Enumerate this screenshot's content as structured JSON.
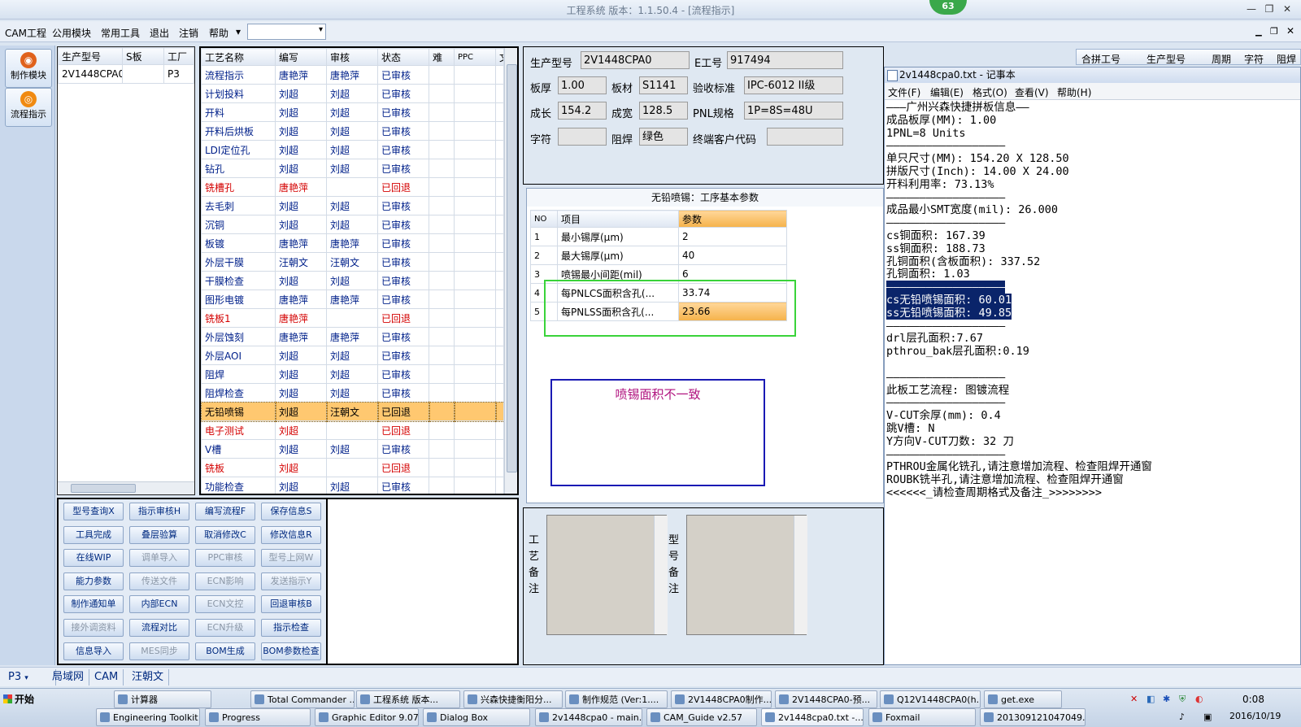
{
  "window": {
    "title": "工程系统   版本：1.1.50.4 - [流程指示]",
    "badge": "63"
  },
  "menu": {
    "items": [
      "CAM工程",
      "公用模块",
      "常用工具",
      "退出",
      "注销",
      "帮助"
    ],
    "arrow": "▾",
    "combo": ""
  },
  "left_tools": [
    {
      "label": "制作模块"
    },
    {
      "label": "流程指示"
    }
  ],
  "prod_grid": {
    "headers": [
      "生产型号",
      "S板",
      "工厂"
    ],
    "rows": [
      [
        "2V1448CPA0",
        "",
        "P3"
      ]
    ]
  },
  "process_grid": {
    "headers": [
      "工艺名称",
      "编写",
      "审核",
      "状态",
      "难",
      "PPC",
      "文控"
    ],
    "rows": [
      {
        "name": "流程指示",
        "author": "唐艳萍",
        "reviewer": "唐艳萍",
        "status": "已审核",
        "red": false
      },
      {
        "name": "计划投料",
        "author": "刘超",
        "reviewer": "刘超",
        "status": "已审核",
        "red": false
      },
      {
        "name": "开料",
        "author": "刘超",
        "reviewer": "刘超",
        "status": "已审核",
        "red": false
      },
      {
        "name": "开料后烘板",
        "author": "刘超",
        "reviewer": "刘超",
        "status": "已审核",
        "red": false
      },
      {
        "name": "LDI定位孔",
        "author": "刘超",
        "reviewer": "刘超",
        "status": "已审核",
        "red": false
      },
      {
        "name": "钻孔",
        "author": "刘超",
        "reviewer": "刘超",
        "status": "已审核",
        "red": false
      },
      {
        "name": "铣槽孔",
        "author": "唐艳萍",
        "reviewer": "",
        "status": "已回退",
        "red": true
      },
      {
        "name": "去毛刺",
        "author": "刘超",
        "reviewer": "刘超",
        "status": "已审核",
        "red": false
      },
      {
        "name": "沉铜",
        "author": "刘超",
        "reviewer": "刘超",
        "status": "已审核",
        "red": false
      },
      {
        "name": "板镀",
        "author": "唐艳萍",
        "reviewer": "唐艳萍",
        "status": "已审核",
        "red": false
      },
      {
        "name": "外层干膜",
        "author": "汪朝文",
        "reviewer": "汪朝文",
        "status": "已审核",
        "red": false
      },
      {
        "name": "干膜检查",
        "author": "刘超",
        "reviewer": "刘超",
        "status": "已审核",
        "red": false
      },
      {
        "name": "图形电镀",
        "author": "唐艳萍",
        "reviewer": "唐艳萍",
        "status": "已审核",
        "red": false
      },
      {
        "name": "铣板1",
        "author": "唐艳萍",
        "reviewer": "",
        "status": "已回退",
        "red": true
      },
      {
        "name": "外层蚀刻",
        "author": "唐艳萍",
        "reviewer": "唐艳萍",
        "status": "已审核",
        "red": false
      },
      {
        "name": "外层AOI",
        "author": "刘超",
        "reviewer": "刘超",
        "status": "已审核",
        "red": false
      },
      {
        "name": "阻焊",
        "author": "刘超",
        "reviewer": "刘超",
        "status": "已审核",
        "red": false
      },
      {
        "name": "阻焊检查",
        "author": "刘超",
        "reviewer": "刘超",
        "status": "已审核",
        "red": false
      },
      {
        "name": "无铅喷锡",
        "author": "刘超",
        "reviewer": "汪朝文",
        "status": "已回退",
        "red": false,
        "selected": true
      },
      {
        "name": "电子测试",
        "author": "刘超",
        "reviewer": "",
        "status": "已回退",
        "red": true
      },
      {
        "name": "V槽",
        "author": "刘超",
        "reviewer": "刘超",
        "status": "已审核",
        "red": false
      },
      {
        "name": "铣板",
        "author": "刘超",
        "reviewer": "",
        "status": "已回退",
        "red": true
      },
      {
        "name": "功能检查",
        "author": "刘超",
        "reviewer": "刘超",
        "status": "已审核",
        "red": false
      }
    ]
  },
  "buttons": [
    [
      {
        "label": "型号查询X",
        "enabled": true
      },
      {
        "label": "指示审核H",
        "enabled": true
      },
      {
        "label": "编写流程F",
        "enabled": true
      },
      {
        "label": "保存信息S",
        "enabled": true
      }
    ],
    [
      {
        "label": "工具完成",
        "enabled": true
      },
      {
        "label": "叠层验算",
        "enabled": true
      },
      {
        "label": "取消修改C",
        "enabled": true
      },
      {
        "label": "修改信息R",
        "enabled": true
      }
    ],
    [
      {
        "label": "在线WIP",
        "enabled": true
      },
      {
        "label": "调单导入",
        "enabled": false
      },
      {
        "label": "PPC审核",
        "enabled": false
      },
      {
        "label": "型号上网W",
        "enabled": false
      }
    ],
    [
      {
        "label": "能力参数",
        "enabled": true
      },
      {
        "label": "传送文件",
        "enabled": false
      },
      {
        "label": "ECN影响",
        "enabled": false
      },
      {
        "label": "发送指示Y",
        "enabled": false
      }
    ],
    [
      {
        "label": "制作通知单",
        "enabled": true
      },
      {
        "label": "内部ECN",
        "enabled": true
      },
      {
        "label": "ECN文控",
        "enabled": false
      },
      {
        "label": "回退审核B",
        "enabled": true
      }
    ],
    [
      {
        "label": "接外调资料",
        "enabled": false
      },
      {
        "label": "流程对比",
        "enabled": true
      },
      {
        "label": "ECN升级",
        "enabled": false
      },
      {
        "label": "指示检查",
        "enabled": true
      }
    ],
    [
      {
        "label": "信息导入",
        "enabled": true
      },
      {
        "label": "MES同步",
        "enabled": false
      },
      {
        "label": "BOM生成",
        "enabled": true
      },
      {
        "label": "BOM参数检查",
        "enabled": true
      }
    ]
  ],
  "form": {
    "model_label": "生产型号",
    "model": "2V1448CPA0",
    "e_label": "E工号",
    "e_no": "917494",
    "thick_label": "板厚",
    "thick": "1.00",
    "material_label": "板材",
    "material": "S1141",
    "std_label": "验收标准",
    "std": "IPC-6012 II级",
    "len_label": "成长",
    "len": "154.2",
    "wid_label": "成宽",
    "wid": "128.5",
    "pnl_label": "PNL规格",
    "pnl": "1P=8S=48U",
    "char_label": "字符",
    "char": "",
    "mask_label": "阻焊",
    "mask": "绿色",
    "cust_label": "终端客户代码",
    "cust": ""
  },
  "params": {
    "title": "无铅喷锡：工序基本参数",
    "headers": [
      "NO",
      "项目",
      "参数"
    ],
    "rows": [
      [
        "1",
        "最小锡厚(μm)",
        "2"
      ],
      [
        "2",
        "最大锡厚(μm)",
        "40"
      ],
      [
        "3",
        "喷锡最小间距(mil)",
        "6"
      ],
      [
        "4",
        "每PNLCS面积含孔(...",
        "33.74"
      ],
      [
        "5",
        "每PNLSS面积含孔(...",
        "23.66"
      ]
    ]
  },
  "note_box": {
    "text": "喷锡面积不一致"
  },
  "remarks": {
    "process_label": "工艺备注",
    "model_label": "型号备注"
  },
  "right_tabs": [
    "合拼工号",
    "生产型号",
    "周期",
    "字符",
    "阻焊"
  ],
  "notepad": {
    "title": "2v1448cpa0.txt - 记事本",
    "menu": [
      "文件(F)",
      "编辑(E)",
      "格式(O)",
      "查看(V)",
      "帮助(H)"
    ],
    "lines": [
      "———广州兴森快捷拼板信息——",
      "成品板厚(MM): 1.00",
      "1PNL=8 Units",
      "——————————————————",
      "单只尺寸(MM): 154.20 X 128.50",
      "拼版尺寸(Inch): 14.00 X 24.00",
      "开料利用率: 73.13%",
      "——————————————————",
      "成品最小SMT宽度(mil): 26.000",
      "——————————————————",
      "cs铜面积: 167.39",
      "ss铜面积: 188.73",
      "孔铜面积(含板面积): 337.52",
      "孔铜面积: 1.03",
      "——————————————————",
      "cs无铅喷锡面积: 60.01",
      "ss无铅喷锡面积: 49.85",
      "——————————————————",
      "drl层孔面积:7.67",
      "pthrou_bak层孔面积:0.19",
      "",
      "——————————————————",
      "此板工艺流程: 图镀流程",
      "——————————————————",
      "V-CUT余厚(mm): 0.4",
      "跳V槽: N",
      "Y方向V-CUT刀数: 32 刀",
      "——————————————————",
      "PTHROU金属化铣孔,请注意增加流程、检查阻焊开通窗",
      "ROUBK铣半孔,请注意增加流程、检查阻焊开通窗",
      "<<<<<<_请检查周期格式及备注_>>>>>>>>"
    ]
  },
  "status_tabs": [
    "P3",
    "局域网",
    "CAM",
    "汪朝文"
  ],
  "taskbar": {
    "start": "开始",
    "row1": [
      "计算器",
      "Total Commander ...",
      "工程系统   版本...",
      "兴森快捷衡阳分...",
      "制作规范 (Ver:1....",
      "2V1448CPA0制作...",
      "2V1448CPA0-预...",
      "Q12V1448CPA0(h...",
      "get.exe"
    ],
    "row2": [
      "Engineering Toolkit ...",
      "Progress",
      "Graphic Editor 9.07...",
      "Dialog Box",
      "2v1448cpa0 - main...",
      "CAM_Guide v2.57",
      "2v1448cpa0.txt -...",
      "Foxmail",
      "201309121047049..."
    ],
    "time": "0:08",
    "date": "2016/10/19"
  }
}
